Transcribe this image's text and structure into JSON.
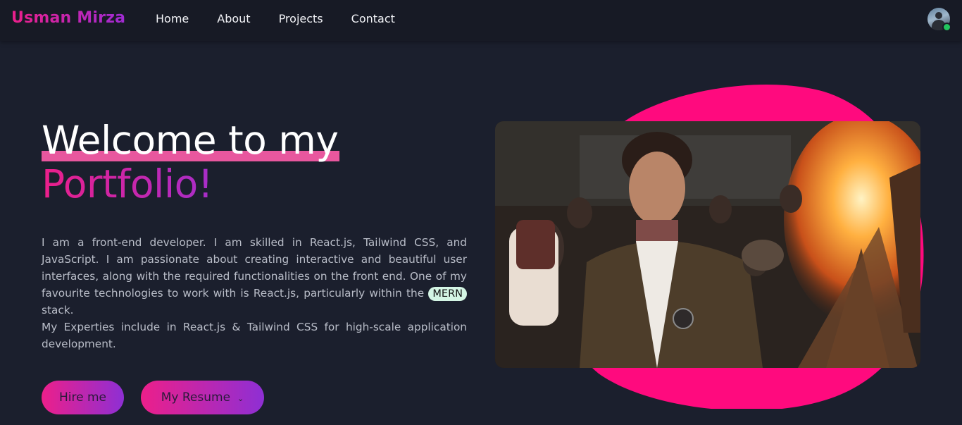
{
  "brand": "Usman Mirza",
  "nav": {
    "links": [
      "Home",
      "About",
      "Projects",
      "Contact"
    ]
  },
  "hero": {
    "title_line1": "Welcome to my",
    "title_line2": "Portfolio!",
    "bio_line1_before": "I am a front-end developer. I am skilled in React.js, Tailwind CSS, and JavaScript. I am passionate about creating interactive and beautiful user interfaces, along with the required functionalities on the front end. One of my favourite technologies to work with is React.js, particularly within the",
    "mern": "MERN",
    "bio_line1_after": "stack.",
    "bio_line2": "My Experties include in React.js & Tailwind CSS for high-scale application development.",
    "hire_button": "Hire me",
    "resume_button": "My Resume"
  },
  "colors": {
    "background": "#1b1f2d",
    "navbar": "#171a25",
    "accent_pink": "#ec1f8a",
    "accent_purple": "#9f2fd1",
    "blob": "#ff0a7e",
    "status_online": "#22c55e"
  }
}
